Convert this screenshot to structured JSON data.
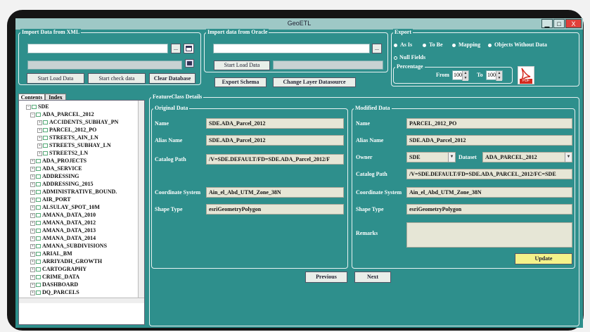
{
  "window": {
    "title": "GeoETL",
    "minimize": "▁",
    "maximize": "□",
    "close": "X"
  },
  "import_xml": {
    "legend": "Import Data from XML",
    "browse_label": "...",
    "start_load": "Start Load Data",
    "start_check": "Start check data",
    "clear_db": "Clear Database"
  },
  "import_oracle": {
    "legend": "Import data from Oracle",
    "browse_label": "...",
    "start_load": "Start Load Data"
  },
  "toolbar": {
    "export_schema": "Export Schema",
    "change_layer": "Change Layer Datasource"
  },
  "export": {
    "legend": "Export",
    "options": [
      "As Is",
      "To Be",
      "Mapping",
      "Objects Without Data"
    ],
    "null_fields": "Null Fields",
    "percentage_legend": "Percentage",
    "from_label": "From",
    "from_value": "100",
    "to_label": "To",
    "to_value": "100",
    "pdf_label": "PDF"
  },
  "tabs": {
    "contents": "Contents",
    "index": "Index"
  },
  "tree": {
    "root": "SDE",
    "items": [
      "ADA_PARCEL_2012",
      "ACCIDENTS_SUBHAY_PN",
      "PARCEL_2012_PO",
      "STREETS_AIN_LN",
      "STREETS_SUBHAY_LN",
      "STREETS2_LN",
      "ADA_PROJECTS",
      "ADA_SERVICE",
      "ADDRESSING",
      "ADDRESSING_2015",
      "ADMINISTRATIVE_BOUND.",
      "AIR_PORT",
      "ALSULAY_SPOT_10M",
      "AMANA_DATA_2010",
      "AMANA_DATA_2012",
      "AMANA_DATA_2013",
      "AMANA_DATA_2014",
      "AMANA_SUBDIVISIONS",
      "ARIAL_BM",
      "ARRIYADH_GROWTH",
      "CARTOGRAPHY",
      "CRIME_DATA",
      "DASHBOARD",
      "DQ_PARCELS"
    ]
  },
  "details": {
    "legend": "FeatureClass Details",
    "original": {
      "legend": "Original Data",
      "name_label": "Name",
      "name_value": "SDE.ADA_Parcel_2012",
      "alias_label": "Alias Name",
      "alias_value": "SDE.ADA_Parcel_2012",
      "catalog_label": "Catalog Path",
      "catalog_value": "/V=SDE.DEFAULT/FD=SDE.ADA_Parcel_2012/F",
      "coord_label": "Coordinate System",
      "coord_value": "Ain_el_Abd_UTM_Zone_38N",
      "shape_label": "Shape Type",
      "shape_value": "esriGeometryPolygon"
    },
    "modified": {
      "legend": "Modified Data",
      "name_label": "Name",
      "name_value": "PARCEL_2012_PO",
      "alias_label": "Alias Name",
      "alias_value": "SDE.ADA_Parcel_2012",
      "owner_label": "Owner",
      "owner_value": "SDE",
      "dataset_label": "Dataset",
      "dataset_value": "ADA_PARCEL_2012",
      "catalog_label": "Catalog Path",
      "catalog_value": "/V=SDE.DEFAULT/FD=SDE.ADA_PARCEL_2012/FC=SDE",
      "coord_label": "Coordinate System",
      "coord_value": "Ain_el_Abd_UTM_Zone_38N",
      "shape_label": "Shape Type",
      "shape_value": "esriGeometryPolygon",
      "remarks_label": "Remarks",
      "remarks_value": "",
      "update": "Update"
    },
    "previous": "Previous",
    "next": "Next"
  },
  "colors": {
    "window_bg": "#2e8f8c",
    "update_button": "#f4f28a",
    "pdf_red": "#d42a1e"
  }
}
